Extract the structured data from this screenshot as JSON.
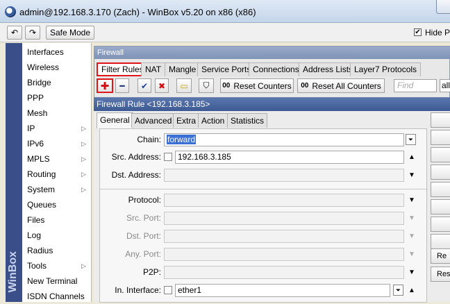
{
  "window": {
    "title": "admin@192.168.3.170 (Zach) - WinBox v5.20 on x86 (x86)"
  },
  "toolbar": {
    "undo_icon": "↶",
    "redo_icon": "↷",
    "safe_mode": "Safe Mode",
    "hide_passwords": "Hide Pa",
    "check": "✔"
  },
  "strip": {
    "brand": "WinBox"
  },
  "sidebar": {
    "items": [
      {
        "label": "Interfaces",
        "submenu": false
      },
      {
        "label": "Wireless",
        "submenu": false
      },
      {
        "label": "Bridge",
        "submenu": false
      },
      {
        "label": "PPP",
        "submenu": false
      },
      {
        "label": "Mesh",
        "submenu": false
      },
      {
        "label": "IP",
        "submenu": true
      },
      {
        "label": "IPv6",
        "submenu": true
      },
      {
        "label": "MPLS",
        "submenu": true
      },
      {
        "label": "Routing",
        "submenu": true
      },
      {
        "label": "System",
        "submenu": true
      },
      {
        "label": "Queues",
        "submenu": false
      },
      {
        "label": "Files",
        "submenu": false
      },
      {
        "label": "Log",
        "submenu": false
      },
      {
        "label": "Radius",
        "submenu": false
      },
      {
        "label": "Tools",
        "submenu": true
      },
      {
        "label": "New Terminal",
        "submenu": false
      },
      {
        "label": "ISDN Channels",
        "submenu": false
      }
    ],
    "arrow": "▷"
  },
  "firewall": {
    "title": "Firewall",
    "tabs": [
      "Filter Rules",
      "NAT",
      "Mangle",
      "Service Ports",
      "Connections",
      "Address Lists",
      "Layer7 Protocols"
    ],
    "actions": {
      "add_icon": "✚",
      "remove_icon": "━",
      "enable_icon": "✔",
      "disable_icon": "✖",
      "comment_icon": "▭",
      "filter_icon": "⛉",
      "oo": "00",
      "reset_counters": "Reset Counters",
      "reset_all_counters": "Reset All Counters",
      "find_placeholder": "Find",
      "all_select": "all"
    }
  },
  "rule": {
    "title": "Firewall Rule <192.168.3.185>",
    "tabs": [
      "General",
      "Advanced",
      "Extra",
      "Action",
      "Statistics"
    ],
    "fields": {
      "chain_label": "Chain:",
      "chain_value": "forward",
      "src_address_label": "Src. Address:",
      "src_address_value": "192.168.3.185",
      "dst_address_label": "Dst. Address:",
      "protocol_label": "Protocol:",
      "src_port_label": "Src. Port:",
      "dst_port_label": "Dst. Port:",
      "any_port_label": "Any. Port:",
      "p2p_label": "P2P:",
      "in_interface_label": "In. Interface:",
      "in_interface_value": "ether1"
    },
    "icons": {
      "dropdown": "▼",
      "up": "▲",
      "combo": "⏷"
    },
    "side_buttons": [
      "",
      "",
      "",
      "",
      "",
      "",
      "",
      "",
      "Re",
      "Rese"
    ]
  }
}
